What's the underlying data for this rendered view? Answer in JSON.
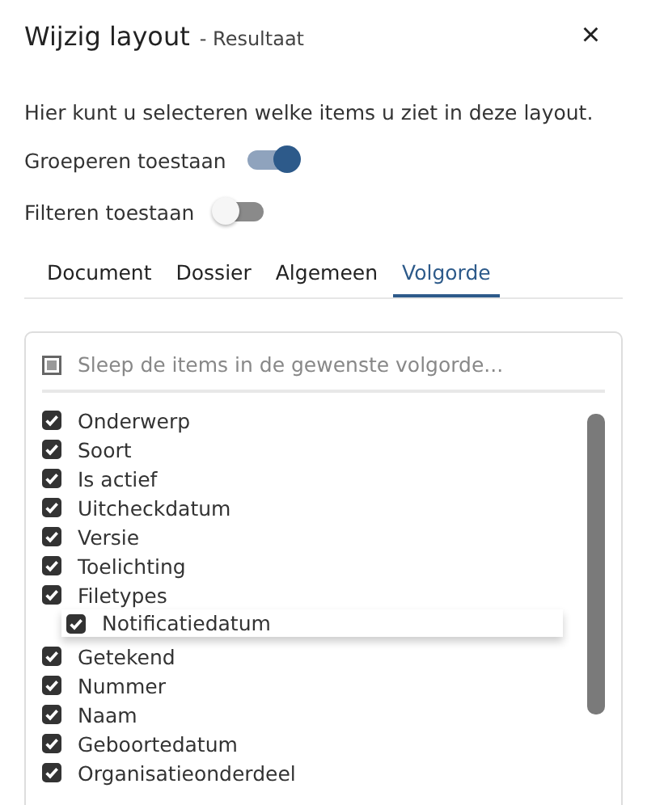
{
  "header": {
    "title": "Wijzig layout",
    "subtitle": "- Resultaat",
    "close": "×"
  },
  "intro": "Hier kunt u selecteren welke items u ziet in deze layout.",
  "toggles": [
    {
      "label": "Groeperen toestaan",
      "on": true
    },
    {
      "label": "Filteren toestaan",
      "on": false
    }
  ],
  "tabs": [
    {
      "label": "Document",
      "selected": false
    },
    {
      "label": "Dossier",
      "selected": false
    },
    {
      "label": "Algemeen",
      "selected": false
    },
    {
      "label": "Volgorde",
      "selected": true
    }
  ],
  "list": {
    "placeholder": "Sleep de items in de gewenste volgorde...",
    "items": [
      {
        "label": "Onderwerp",
        "checked": true
      },
      {
        "label": "Soort",
        "checked": true
      },
      {
        "label": "Is actief",
        "checked": true
      },
      {
        "label": "Uitcheckdatum",
        "checked": true
      },
      {
        "label": "Versie",
        "checked": true
      },
      {
        "label": "Toelichting",
        "checked": true
      },
      {
        "label": "Filetypes",
        "checked": true
      },
      {
        "label": "Notificatiedatum",
        "checked": true,
        "kind": "dragged"
      },
      {
        "label": "Getekend",
        "checked": true
      },
      {
        "label": "Nummer",
        "checked": true
      },
      {
        "label": "Naam",
        "checked": true
      },
      {
        "label": "Geboortedatum",
        "checked": true
      },
      {
        "label": "Organisatieonderdeel",
        "checked": true
      }
    ]
  }
}
